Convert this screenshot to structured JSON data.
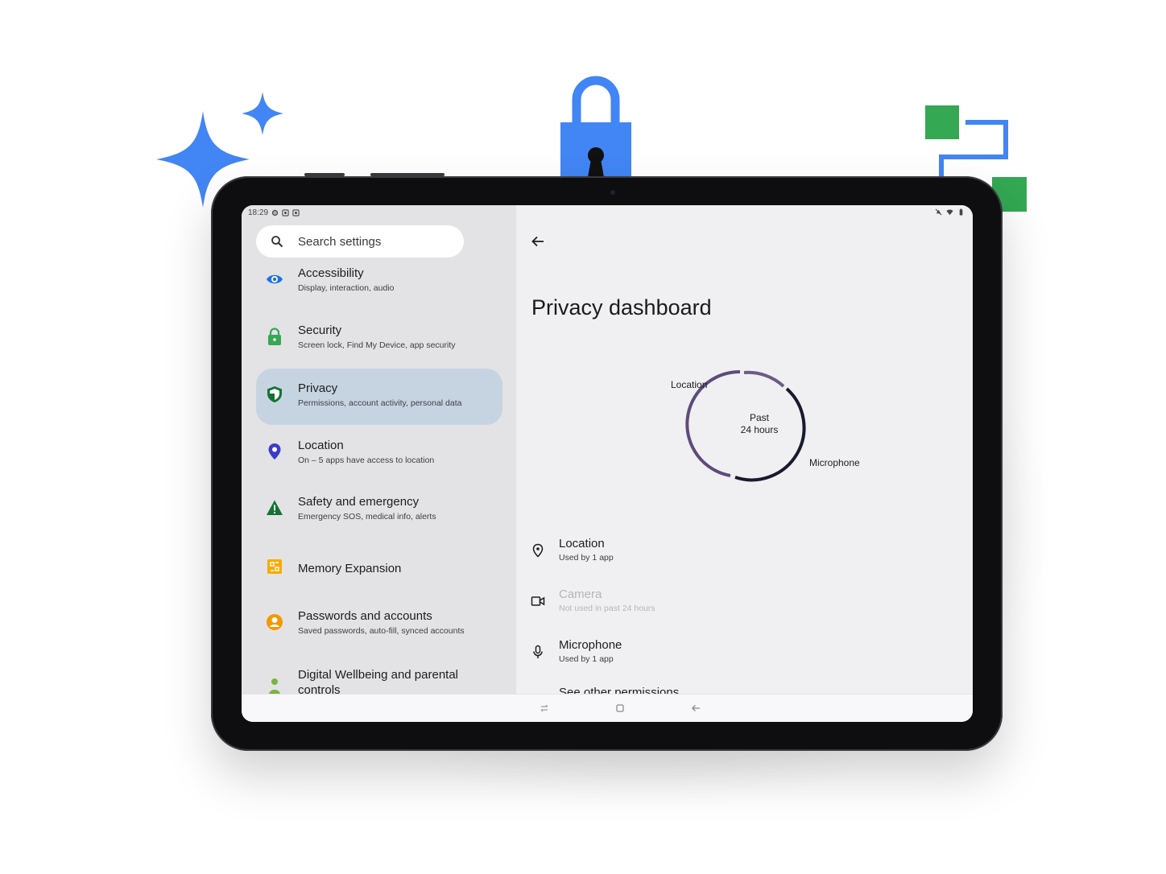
{
  "status": {
    "time": "18:29"
  },
  "search": {
    "placeholder": "Search settings",
    "icon": "search-icon"
  },
  "sidebar": {
    "items": [
      {
        "title": "Accessibility",
        "subtitle": "Display, interaction, audio",
        "icon": "eye-icon",
        "color": "#1a73e8"
      },
      {
        "title": "Security",
        "subtitle": "Screen lock, Find My Device, app security",
        "icon": "padlock-icon",
        "color": "#34a853"
      },
      {
        "title": "Privacy",
        "subtitle": "Permissions, account activity, personal data",
        "icon": "shield-icon",
        "color": "#1e8e3e",
        "selected": true
      },
      {
        "title": "Location",
        "subtitle": "On – 5 apps have access to location",
        "icon": "location-pin-icon",
        "color": "#3c3cc8"
      },
      {
        "title": "Safety and emergency",
        "subtitle": "Emergency SOS, medical info, alerts",
        "icon": "warning-icon",
        "color": "#137333"
      },
      {
        "title": "Memory Expansion",
        "subtitle": "",
        "icon": "memory-chip-icon",
        "color": "#f9ab00"
      },
      {
        "title": "Passwords and accounts",
        "subtitle": "Saved passwords, auto-fill, synced accounts",
        "icon": "account-icon",
        "color": "#f29900"
      },
      {
        "title": "Digital Wellbeing and parental controls",
        "subtitle": "",
        "icon": "wellbeing-icon",
        "color": "#7cb342"
      }
    ]
  },
  "main": {
    "title": "Privacy dashboard",
    "chart": {
      "center_line1": "Past",
      "center_line2": "24 hours",
      "label_location": "Location",
      "label_microphone": "Microphone",
      "ring_colors": [
        "#5e4b7a",
        "#1a1a2e"
      ]
    },
    "permissions": [
      {
        "title": "Location",
        "subtitle": "Used by 1 app",
        "icon": "location-pin-icon",
        "disabled": false
      },
      {
        "title": "Camera",
        "subtitle": "Not used in past 24 hours",
        "icon": "video-camera-icon",
        "disabled": true
      },
      {
        "title": "Microphone",
        "subtitle": "Used by 1 app",
        "icon": "microphone-icon",
        "disabled": false
      }
    ],
    "see_other": "See other permissions"
  },
  "colors": {
    "brand_blue": "#4285f4",
    "brand_green": "#34a853"
  }
}
